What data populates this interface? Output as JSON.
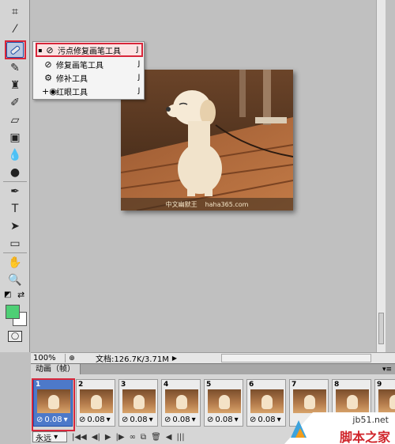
{
  "toolbox": {
    "tools": [
      "crop-icon",
      "eyedropper-icon",
      "spot-healing-brush-icon",
      "brush-icon",
      "clone-stamp-icon",
      "history-brush-icon",
      "eraser-icon",
      "gradient-icon",
      "blur-icon",
      "dodge-icon",
      "pen-icon",
      "type-icon",
      "path-selection-icon",
      "rectangle-icon",
      "hand-icon",
      "zoom-icon"
    ],
    "foreground_color": "#4ecf75",
    "background_color": "#ffffff"
  },
  "flyout": {
    "items": [
      {
        "label": "污点修复画笔工具",
        "key": "J",
        "icon": "spot-healing-brush-icon",
        "active": true
      },
      {
        "label": "修复画笔工具",
        "key": "J",
        "icon": "healing-brush-icon",
        "active": false
      },
      {
        "label": "修补工具",
        "key": "J",
        "icon": "patch-icon",
        "active": false
      },
      {
        "label": "红眼工具",
        "key": "J",
        "icon": "red-eye-icon",
        "active": false
      }
    ]
  },
  "document": {
    "caption_left": "中文幽默王",
    "caption_right": "haha365.com"
  },
  "statusbar": {
    "zoom": "100%",
    "doc_info": "文档:126.7K/3.71M",
    "arrow": "▶"
  },
  "animation": {
    "tab_label": "动画（帧）",
    "menu_icon": "▾≡",
    "frames": [
      {
        "num": "1",
        "delay": "0.08",
        "selected": true
      },
      {
        "num": "2",
        "delay": "0.08",
        "selected": false
      },
      {
        "num": "3",
        "delay": "0.08",
        "selected": false
      },
      {
        "num": "4",
        "delay": "0.08",
        "selected": false
      },
      {
        "num": "5",
        "delay": "0.08",
        "selected": false
      },
      {
        "num": "6",
        "delay": "0.08",
        "selected": false
      },
      {
        "num": "7",
        "delay": "",
        "selected": false
      },
      {
        "num": "8",
        "delay": "",
        "selected": false
      },
      {
        "num": "9",
        "delay": "",
        "selected": false
      }
    ],
    "loop": "永远"
  },
  "watermark": {
    "url": "jb51.net",
    "name": "脚本之家"
  }
}
